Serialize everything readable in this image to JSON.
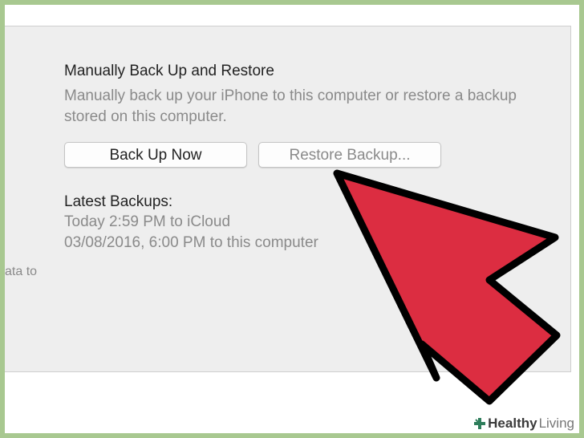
{
  "section": {
    "title": "Manually Back Up and Restore",
    "description": "Manually back up your iPhone to this computer or restore a backup stored on this computer."
  },
  "buttons": {
    "backup_now": "Back Up Now",
    "restore_backup": "Restore Backup..."
  },
  "latest_backups": {
    "title": "Latest Backups:",
    "lines": [
      "Today 2:59 PM to iCloud",
      "03/08/2016, 6:00 PM to this computer"
    ]
  },
  "cutoff_text": "ata to",
  "watermark": {
    "healthy": "Healthy",
    "living": "Living"
  },
  "colors": {
    "arrow_fill": "#dc2d41",
    "arrow_stroke": "#000000",
    "frame_border": "#a8c890"
  },
  "icons": {
    "arrow": "red-pointer-arrow",
    "watermark": "healthy-living-cross-icon"
  }
}
